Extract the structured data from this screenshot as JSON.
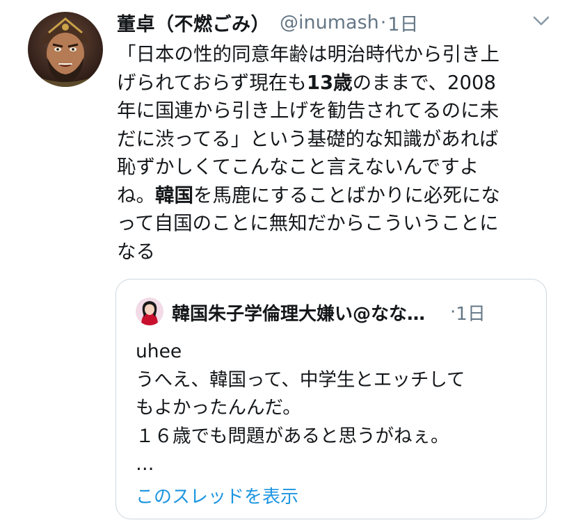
{
  "tweet": {
    "display_name": "董卓（不燃ごみ）",
    "handle": "@inumash",
    "separator": "·",
    "time": "1日",
    "body_lines": [
      {
        "pre": "「日本の性的同意年齢は明治時代から引き上",
        "bold": "",
        "post": ""
      },
      {
        "pre": "げられておらず現在も",
        "bold": "13歳",
        "post": "のままで、2008"
      },
      {
        "pre": "年に国連から引き上げを勧告されてるのに未",
        "bold": "",
        "post": ""
      },
      {
        "pre": "だに渋ってる」という基礎的な知識があれば",
        "bold": "",
        "post": ""
      },
      {
        "pre": "恥ずかしくてこんなこと言えないんですよ",
        "bold": "",
        "post": ""
      },
      {
        "pre": "ね。",
        "bold": "韓国",
        "post": "を馬鹿にすることばかりに必死にな"
      },
      {
        "pre": "って自国のことに無知だからこういうことに",
        "bold": "",
        "post": ""
      },
      {
        "pre": "なる",
        "bold": "",
        "post": ""
      }
    ]
  },
  "quoted": {
    "display_name": "韓国朱子学倫理大嫌い@なな…",
    "separator": "·",
    "time": "1日",
    "body_lines": [
      "uhee",
      "うへえ、韓国って、中学生とエッチして",
      "もよかったんんだ。",
      "１６歳でも問題があると思うがねぇ。",
      "…"
    ],
    "thread_link": "このスレッドを表示"
  },
  "colors": {
    "text": "#14171a",
    "secondary": "#657786",
    "link": "#1b95e0",
    "border": "#ccd6dd"
  },
  "icons": {
    "avatar": "warlord-portrait-avatar",
    "quoted_avatar": "girl-portrait-avatar",
    "caret": "chevron-down-icon"
  }
}
